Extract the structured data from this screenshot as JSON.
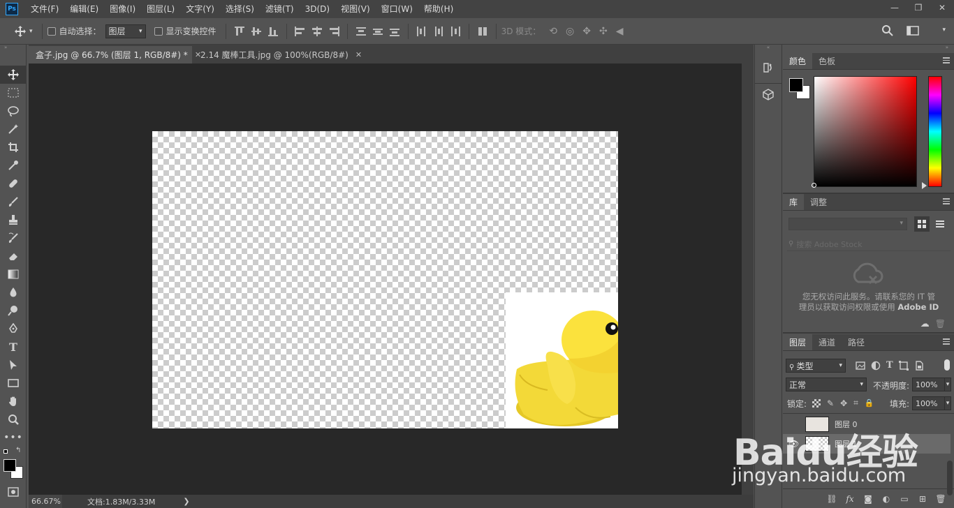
{
  "app": {
    "logo": "Ps",
    "accent": "#31a8ff"
  },
  "menu": [
    "文件(F)",
    "编辑(E)",
    "图像(I)",
    "图层(L)",
    "文字(Y)",
    "选择(S)",
    "滤镜(T)",
    "3D(D)",
    "视图(V)",
    "窗口(W)",
    "帮助(H)"
  ],
  "window_controls": {
    "minimize": "—",
    "restore": "❐",
    "close": "✕"
  },
  "options": {
    "auto_select_label": "自动选择：",
    "auto_select_target": "图层",
    "show_transform_label": "显示变换控件",
    "mode_3d_label": "3D 模式："
  },
  "tabs": [
    {
      "label": "盒子.jpg @ 66.7% (图层 1, RGB/8#) *",
      "close": "✕"
    },
    {
      "label": "2.14 魔棒工具.jpg @ 100%(RGB/8#)",
      "close": "✕"
    }
  ],
  "status": {
    "zoom": "66.67%",
    "doc": "文档:1.83M/3.33M",
    "arrow": "❯"
  },
  "color_panel": {
    "tabs": [
      "颜色",
      "色板"
    ],
    "foreground": "#000000",
    "background": "#ffffff",
    "hue_color": "#ff0000"
  },
  "library_panel": {
    "tabs": [
      "库",
      "调整"
    ],
    "search_placeholder": "搜索 Adobe Stock",
    "message_line1": "您无权访问此服务。请联系您的 IT 管",
    "message_line2": "理员以获取访问权限或使用",
    "message_adobe_id": "Adobe ID"
  },
  "layers_panel": {
    "tabs": [
      "图层",
      "通道",
      "路径"
    ],
    "filter_label": "类型",
    "blend_mode": "正常",
    "opacity_label": "不透明度:",
    "opacity_value": "100%",
    "lock_label": "锁定:",
    "fill_label": "填充:",
    "fill_value": "100%",
    "layers": [
      {
        "name": "图层 0"
      },
      {
        "name": "图层 1"
      }
    ],
    "footer_fx": "fx"
  },
  "watermark": {
    "brand": "Baidu经验",
    "url": "jingyan.baidu.com"
  }
}
